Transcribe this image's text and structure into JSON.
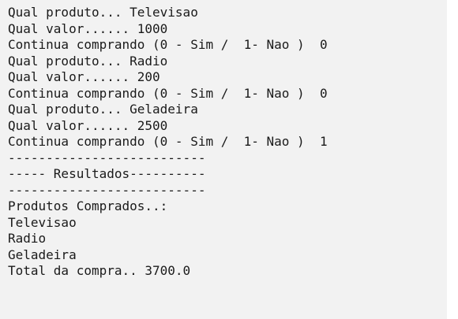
{
  "console": {
    "lines": [
      "Qual produto... Televisao",
      "Qual valor...... 1000",
      "Continua comprando (0 - Sim /  1- Nao )  0",
      "Qual produto... Radio",
      "Qual valor...... 200",
      "Continua comprando (0 - Sim /  1- Nao )  0",
      "Qual produto... Geladeira",
      "Qual valor...... 2500",
      "Continua comprando (0 - Sim /  1- Nao )  1",
      "--------------------------",
      "----- Resultados----------",
      "--------------------------",
      "Produtos Comprados..:",
      "Televisao",
      "Radio",
      "Geladeira",
      "Total da compra.. 3700.0"
    ]
  }
}
